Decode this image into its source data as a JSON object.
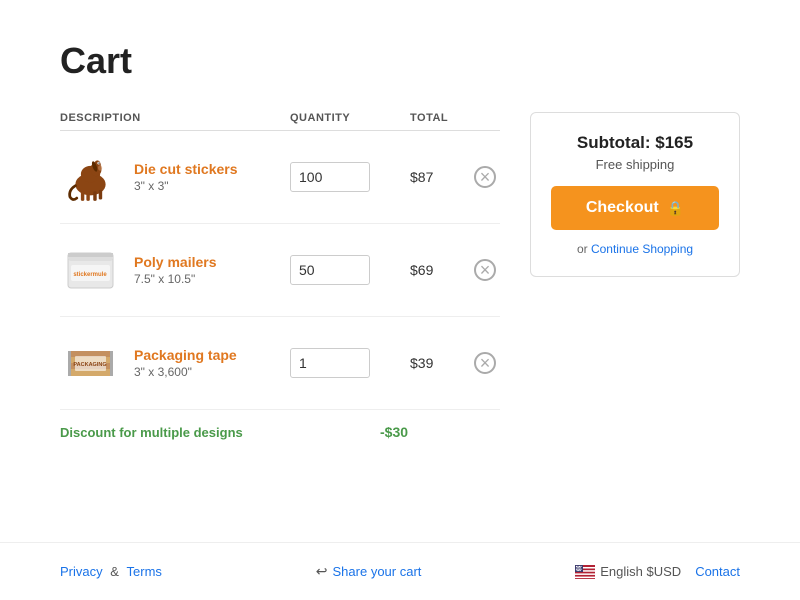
{
  "page": {
    "title": "Cart"
  },
  "table": {
    "headers": {
      "description": "DESCRIPTION",
      "quantity": "QUANTITY",
      "total": "TOTAL"
    }
  },
  "items": [
    {
      "id": "die-cut-stickers",
      "name": "Die cut stickers",
      "size": "3\" x 3\"",
      "quantity": "100",
      "total": "$87",
      "image_type": "horse"
    },
    {
      "id": "poly-mailers",
      "name": "Poly mailers",
      "size": "7.5\" x 10.5\"",
      "quantity": "50",
      "total": "$69",
      "image_type": "poly"
    },
    {
      "id": "packaging-tape",
      "name": "Packaging tape",
      "size": "3\" x 3,600\"",
      "quantity": "1",
      "total": "$39",
      "image_type": "tape"
    }
  ],
  "discount": {
    "label": "Discount for multiple designs",
    "amount": "-$30"
  },
  "sidebar": {
    "subtotal": "Subtotal: $165",
    "shipping": "Free shipping",
    "checkout_label": "Checkout",
    "or_text": "or",
    "continue_label": "Continue Shopping"
  },
  "footer": {
    "privacy_label": "Privacy",
    "and_text": "&",
    "terms_label": "Terms",
    "share_label": "Share your cart",
    "language_label": "English $USD",
    "contact_label": "Contact"
  }
}
